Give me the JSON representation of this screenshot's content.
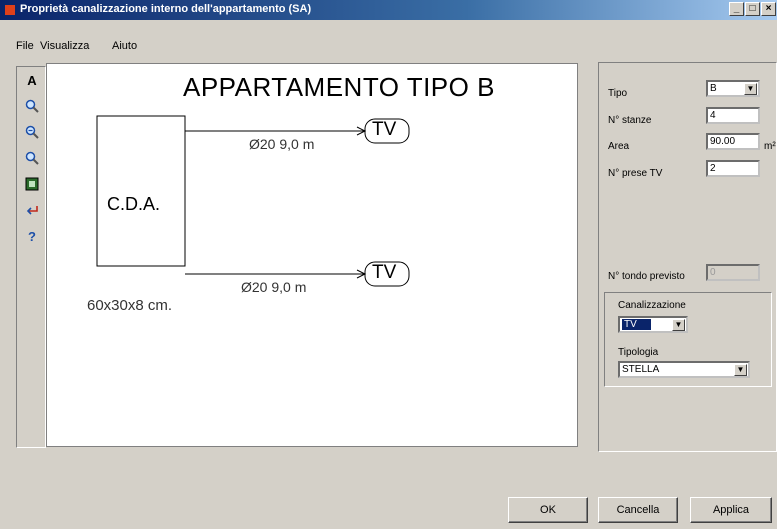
{
  "window": {
    "title": "Proprietà canalizzazione interno dell'appartamento (SA)",
    "minimize": "_",
    "maximize": "□",
    "close": "×"
  },
  "menu": [
    "File",
    "Visualizza",
    "Aiuto"
  ],
  "toolbar": {
    "items": [
      {
        "name": "text-tool-icon",
        "glyph": "A"
      },
      {
        "name": "zoom-icon",
        "glyph": "🔍"
      },
      {
        "name": "zoom-in-icon",
        "glyph": "🔍"
      },
      {
        "name": "zoom-out-icon",
        "glyph": "🔍"
      },
      {
        "name": "fit-view-icon",
        "glyph": "▣"
      },
      {
        "name": "pick-tool-icon",
        "glyph": "↲"
      },
      {
        "name": "help-icon",
        "glyph": "?"
      }
    ]
  },
  "diagram": {
    "title": "APPARTAMENTO TIPO B",
    "box_label": "C.D.A.",
    "box_dims": "60x30x8 cm.",
    "outlet_1": {
      "label": "TV",
      "pipe": "Ø20 9,0 m"
    },
    "outlet_2": {
      "label": "TV",
      "pipe": "Ø20 9,0 m"
    }
  },
  "properties": {
    "tipo_label": "Tipo",
    "tipo_value": "B",
    "stanze_label": "N° stanze",
    "stanze_value": "4",
    "area_label": "Area",
    "area_value": "90.00",
    "area_unit": "m²",
    "prese_label": "N° prese TV",
    "prese_value": "2",
    "tondo_label": "N° tondo previsto",
    "tondo_value": "0",
    "canalizzazione_label": "Canalizzazione",
    "canalizzazione_value": "TV",
    "tipologia_label": "Tipologia",
    "tipologia_value": "STELLA"
  },
  "buttons": {
    "ok": "OK",
    "cancel": "Cancella",
    "apply": "Applica"
  }
}
